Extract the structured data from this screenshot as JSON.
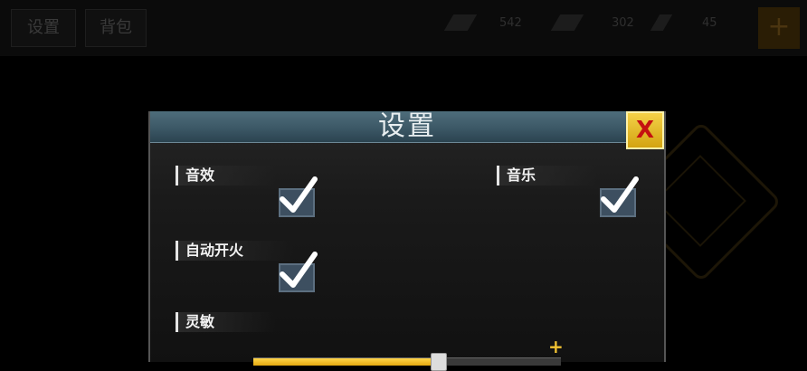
{
  "background": {
    "tabs": [
      "设置",
      "背包"
    ],
    "resources": [
      {
        "icon": "diamond-icon",
        "value": "542"
      },
      {
        "icon": "coin-icon",
        "value": "302"
      },
      {
        "icon": "energy-icon",
        "value": "45"
      }
    ],
    "add_label": "+"
  },
  "dialog": {
    "title": "设置",
    "close_label": "X",
    "options": {
      "sound_effects": {
        "label": "音效",
        "checked": true
      },
      "music": {
        "label": "音乐",
        "checked": true
      },
      "auto_fire": {
        "label": "自动开火",
        "checked": true
      }
    },
    "sensitivity": {
      "label": "灵敏",
      "value_fraction": 0.6,
      "plus_label": "+"
    }
  },
  "colors": {
    "accent": "#f1c232",
    "header": "#4e6d7b",
    "close_x": "#c41111"
  }
}
